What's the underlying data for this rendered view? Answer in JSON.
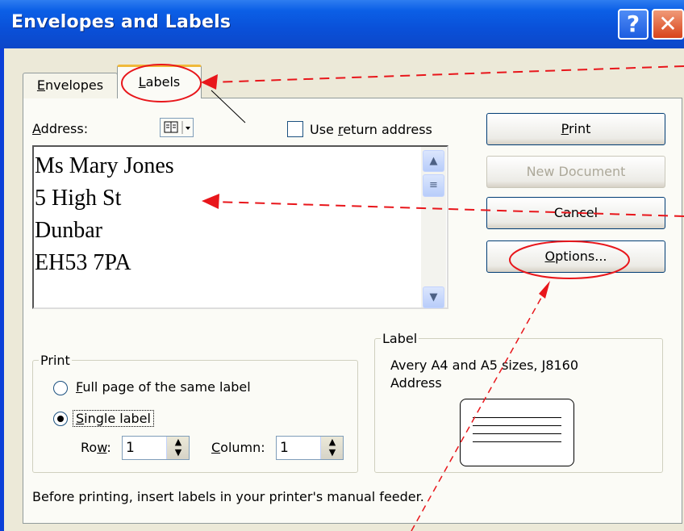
{
  "window": {
    "title": "Envelopes and Labels",
    "help_glyph": "?",
    "close_glyph": "✕"
  },
  "tabs": [
    {
      "label": "Envelopes",
      "accel": "E",
      "rest": "nvelopes"
    },
    {
      "label": "Labels",
      "accel": "L",
      "rest": "abels"
    }
  ],
  "address": {
    "label_accel": "A",
    "label_rest": "ddress:",
    "book_icon": "address-book-icon",
    "use_return_pre": "Use ",
    "use_return_accel": "r",
    "use_return_rest": "eturn address",
    "lines": [
      "Ms Mary Jones",
      "5 High St",
      "Dunbar",
      "EH53 7PA"
    ]
  },
  "buttons": {
    "print_accel": "P",
    "print_rest": "rint",
    "new_document": "New Document",
    "cancel": "Cancel",
    "options_accel": "O",
    "options_rest": "ptions..."
  },
  "print_group": {
    "legend": "Print",
    "full_accel": "F",
    "full_rest": "ull page of the same label",
    "single_accel": "S",
    "single_rest": "ingle label",
    "row_pre": "Ro",
    "row_accel": "w",
    "row_post": ":",
    "row_value": "1",
    "col_accel": "C",
    "col_rest": "olumn:",
    "col_value": "1",
    "selected": "single"
  },
  "label_group": {
    "legend": "Label",
    "description": "Avery A4 and A5 sizes, J8160\nAddress"
  },
  "footer_note": "Before printing, insert labels in your printer's manual feeder.",
  "annotation_color": "#e8161b"
}
